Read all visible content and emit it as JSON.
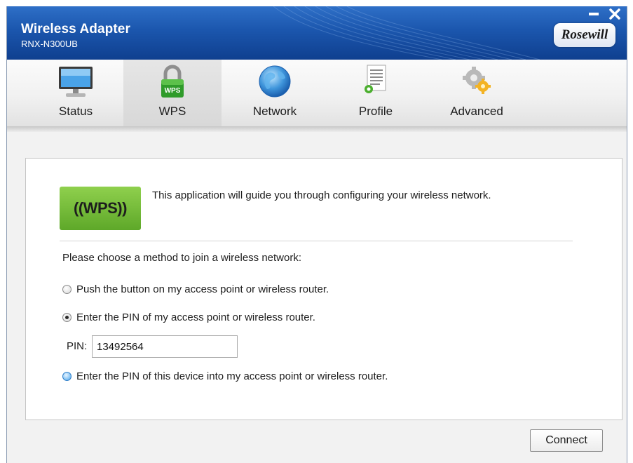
{
  "window": {
    "title": "Wireless Adapter",
    "subtitle": "RNX-N300UB",
    "brand": "Rosewill",
    "minimize_icon": "minimize-icon",
    "close_icon": "close-icon"
  },
  "toolbar": {
    "active_tab": "WPS",
    "tabs": [
      {
        "label": "Status",
        "icon": "monitor-icon"
      },
      {
        "label": "WPS",
        "icon": "wps-lock-icon"
      },
      {
        "label": "Network",
        "icon": "globe-icon"
      },
      {
        "label": "Profile",
        "icon": "profile-document-icon"
      },
      {
        "label": "Advanced",
        "icon": "gears-icon"
      }
    ]
  },
  "content": {
    "logo_text": "((WPS))",
    "intro": "This application will guide you through configuring your wireless network.",
    "prompt": "Please choose a method to join a wireless network:",
    "options": [
      {
        "label": "Push the button on my access point or wireless router.",
        "selected": false
      },
      {
        "label": "Enter the PIN of my access point or wireless router.",
        "selected": true
      },
      {
        "label": "Enter the PIN of this device into my access point or wireless router.",
        "selected": false
      }
    ],
    "pin_label": "PIN:",
    "pin_value": "13492564"
  },
  "actions": {
    "connect_label": "Connect"
  },
  "colors": {
    "titlebar": "#1b56ad",
    "wps_green": "#6bb536",
    "radio_blue": "#3d8fd6"
  }
}
